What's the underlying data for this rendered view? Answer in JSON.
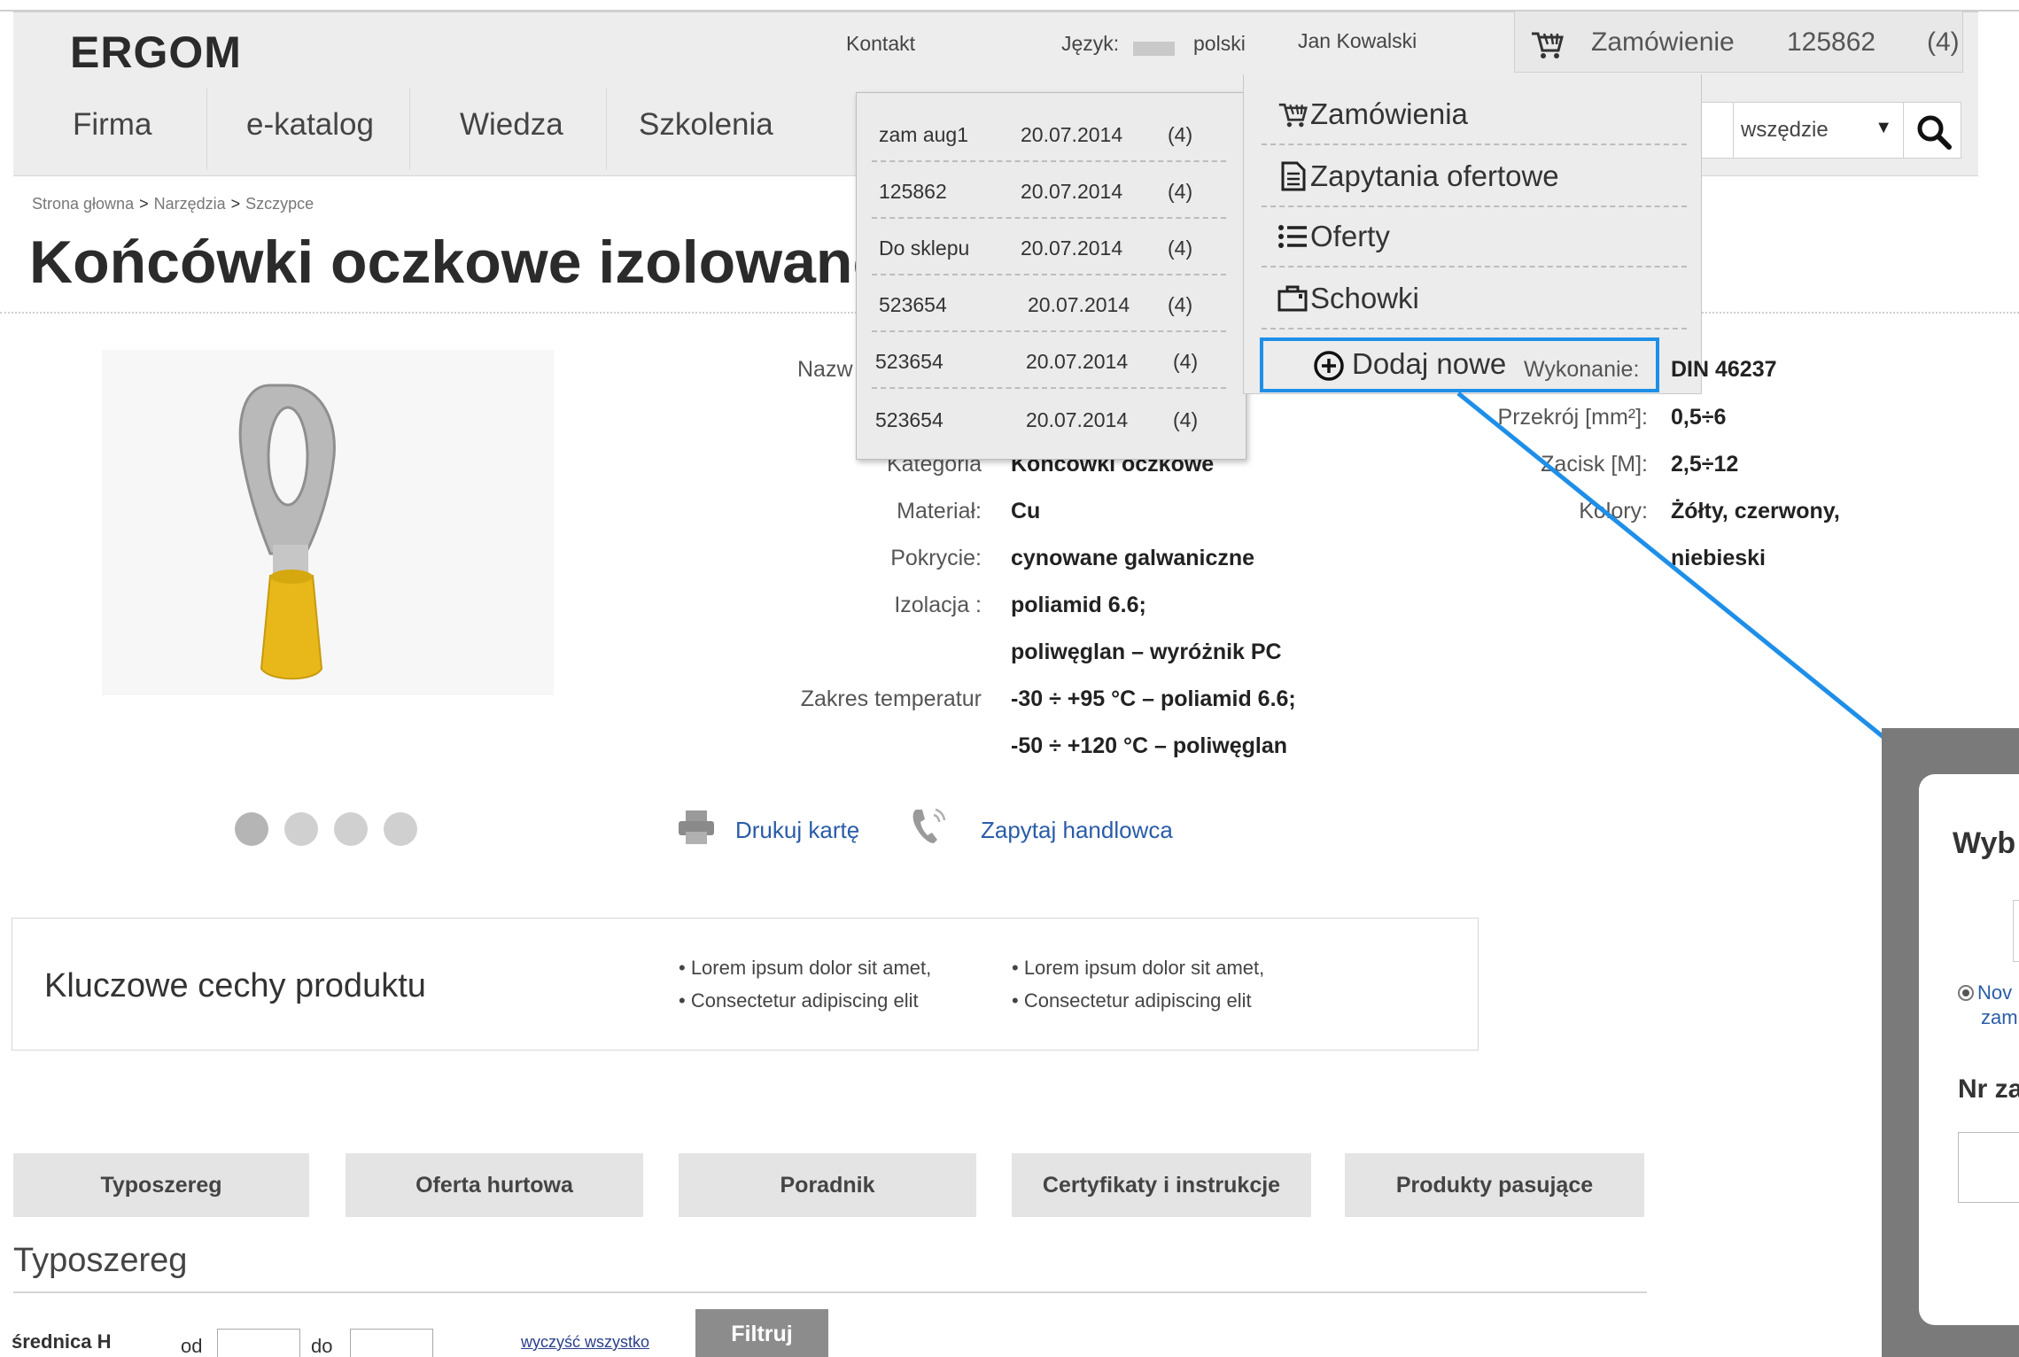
{
  "header": {
    "logo": "ERGOM",
    "contact": "Kontakt",
    "language_label": "Język:",
    "language_value": "polski",
    "user_name": "Jan Kowalski",
    "order_label": "Zamówienie",
    "order_number": "125862",
    "order_count": "(4)"
  },
  "nav": {
    "items": [
      {
        "label": "Firma"
      },
      {
        "label": "e-katalog"
      },
      {
        "label": "Wiedza"
      },
      {
        "label": "Szkolenia"
      }
    ]
  },
  "search": {
    "scope_value": "wszędzie"
  },
  "breadcrumb": [
    "Strona głowna",
    "Narzędzia",
    "Szczypce"
  ],
  "page_title": "Końcówki oczkowe izolowane",
  "specs": {
    "left_col": [
      {
        "label": "Nazw",
        "value": ""
      },
      {
        "label": "Kategoria",
        "value": "Końcówki oczkowe"
      },
      {
        "label": "Materiał:",
        "value": "Cu"
      },
      {
        "label": "Pokrycie:",
        "value": "cynowane galwaniczne"
      },
      {
        "label": "Izolacja :",
        "value": "poliamid 6.6;"
      },
      {
        "label": "",
        "value": "poliwęglan – wyróżnik PC"
      },
      {
        "label": "Zakres temperatur",
        "value": "-30 ÷ +95 °C – poliamid 6.6;"
      },
      {
        "label": "",
        "value": "-50 ÷ +120 °C – poliwęglan"
      }
    ],
    "right_col": [
      {
        "label": "Wykonanie:",
        "value": "DIN 46237"
      },
      {
        "label": "Przekrój [mm²]:",
        "value": "0,5÷6"
      },
      {
        "label": "Zacisk [M]:",
        "value": "2,5÷12"
      },
      {
        "label": "Kolory:",
        "value": "Żółty, czerwony,"
      },
      {
        "label": "",
        "value": "niebieski"
      }
    ]
  },
  "actions": {
    "print": "Drukuj kartę",
    "ask": "Zapytaj handlowca"
  },
  "features": {
    "title": "Kluczowe cechy produktu",
    "col1": [
      "• Lorem ipsum dolor sit amet,",
      "• Consectetur adipiscing elit"
    ],
    "col2": [
      "• Lorem ipsum dolor sit amet,",
      "• Consectetur adipiscing elit"
    ]
  },
  "tabs": [
    {
      "label": "Typoszereg"
    },
    {
      "label": "Oferta hurtowa"
    },
    {
      "label": "Poradnik"
    },
    {
      "label": "Certyfikaty i instrukcje"
    },
    {
      "label": "Produkty pasujące"
    }
  ],
  "section": {
    "title": "Typoszereg",
    "filter_label": "średnica H",
    "from_label": "od",
    "to_label": "do",
    "clear_label": "wyczyść wszystko",
    "filter_button": "Filtruj"
  },
  "order_list": [
    {
      "name": "zam aug1",
      "date": "20.07.2014",
      "count": "(4)"
    },
    {
      "name": "125862",
      "date": "20.07.2014",
      "count": "(4)"
    },
    {
      "name": "Do sklepu",
      "date": "20.07.2014",
      "count": "(4)"
    },
    {
      "name": "523654",
      "date": "20.07.2014",
      "count": "(4)"
    },
    {
      "name": "523654",
      "date": "20.07.2014",
      "count": "(4)"
    },
    {
      "name": "523654",
      "date": "20.07.2014",
      "count": "(4)"
    }
  ],
  "menu": {
    "items": [
      {
        "label": "Zamówienia",
        "icon": "cart-icon"
      },
      {
        "label": "Zapytania ofertowe",
        "icon": "document-icon"
      },
      {
        "label": "Oferty",
        "icon": "list-icon"
      },
      {
        "label": "Schowki",
        "icon": "briefcase-icon"
      }
    ],
    "add_new": "Dodaj nowe",
    "highlight_color": "#1e8fe8"
  },
  "modal": {
    "title_fragment": "Wyb",
    "radio_fragment_1": "Nov",
    "radio_fragment_2": "zam",
    "field_fragment": "Nr za"
  }
}
